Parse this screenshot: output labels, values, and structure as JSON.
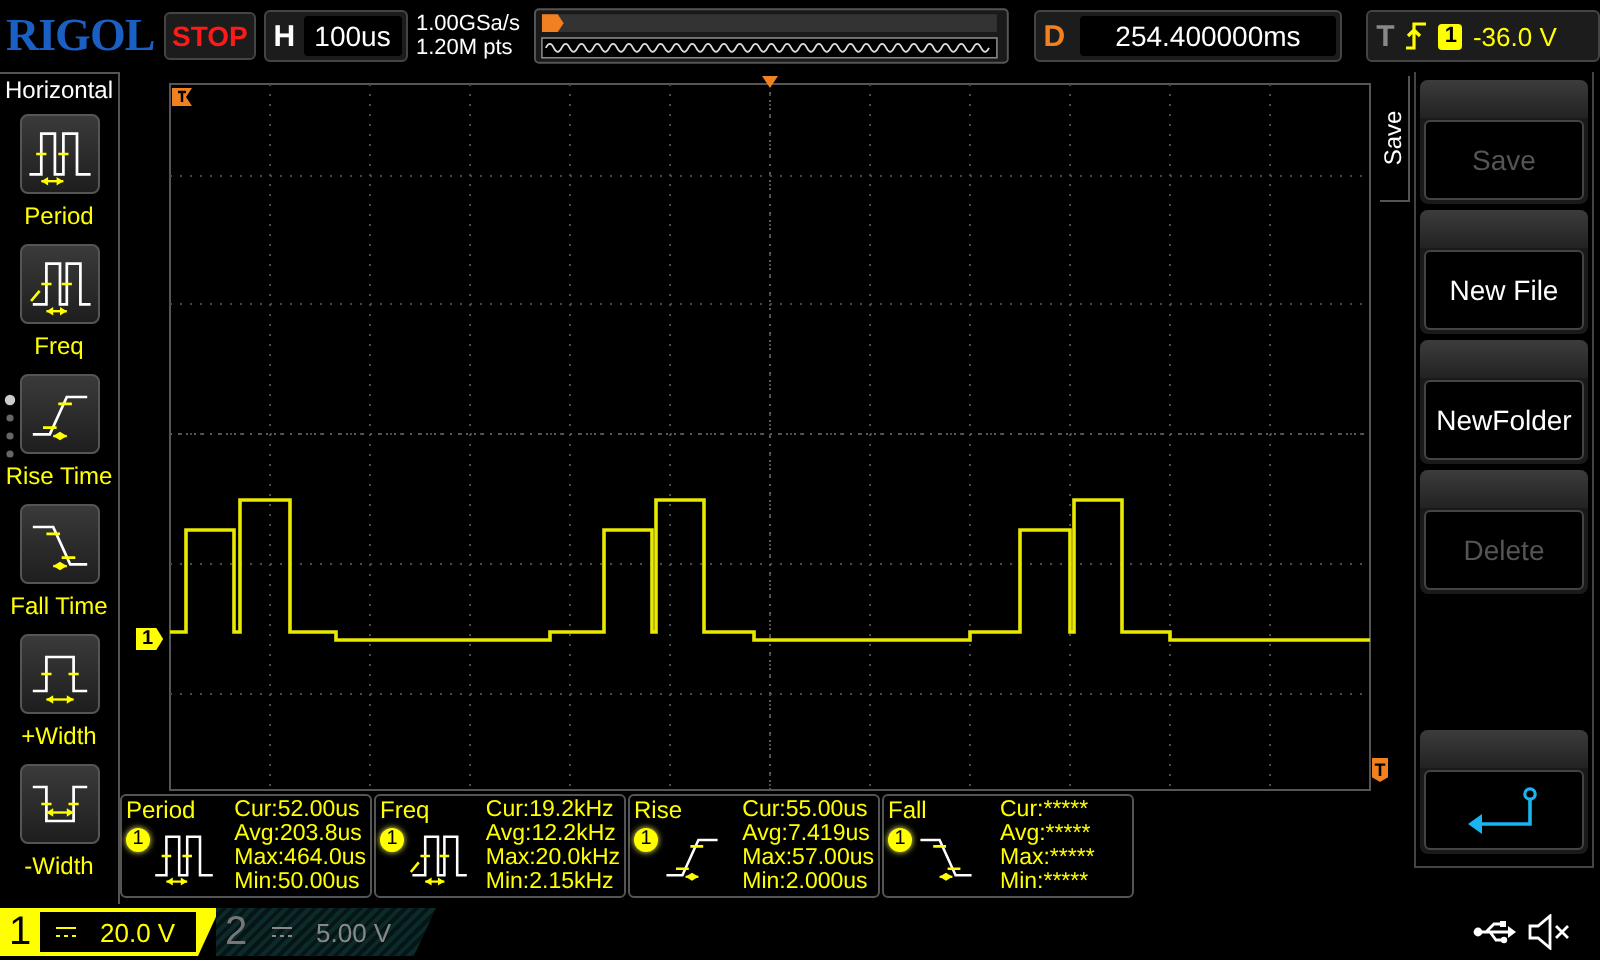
{
  "logo": "RIGOL",
  "run_state": "STOP",
  "timebase": {
    "label": "H",
    "value": "100us"
  },
  "acquisition": {
    "sample_rate": "1.00GSa/s",
    "memory_depth": "1.20M pts"
  },
  "delay": {
    "label": "D",
    "value": "254.400000ms"
  },
  "trigger": {
    "label": "T",
    "channel": "1",
    "level": "-36.0 V"
  },
  "measure_menu": {
    "title": "Horizontal",
    "items": [
      {
        "label": "Period",
        "kind": "period"
      },
      {
        "label": "Freq",
        "kind": "freq"
      },
      {
        "label": "Rise Time",
        "kind": "rise"
      },
      {
        "label": "Fall Time",
        "kind": "fall"
      },
      {
        "label": "+Width",
        "kind": "pwidth"
      },
      {
        "label": "-Width",
        "kind": "nwidth"
      }
    ]
  },
  "waveform": {
    "channel_marker": "1",
    "trigger_marker": "T"
  },
  "save_menu": {
    "title": "Save",
    "buttons": [
      {
        "kind": "text",
        "label": "Save",
        "disabled": true
      },
      {
        "kind": "text",
        "label": "New File",
        "disabled": false
      },
      {
        "kind": "text",
        "label": "NewFolder",
        "disabled": false
      },
      {
        "kind": "text",
        "label": "Delete",
        "disabled": true
      },
      {
        "kind": "back"
      }
    ]
  },
  "measurements": [
    {
      "name": "Period",
      "channel": "1",
      "kind": "period",
      "stats": [
        "Cur:52.00us",
        "Avg:203.8us",
        "Max:464.0us",
        "Min:50.00us"
      ]
    },
    {
      "name": "Freq",
      "channel": "1",
      "kind": "freq",
      "stats": [
        "Cur:19.2kHz",
        "Avg:12.2kHz",
        "Max:20.0kHz",
        "Min:2.15kHz"
      ]
    },
    {
      "name": "Rise",
      "channel": "1",
      "kind": "rise",
      "stats": [
        "Cur:55.00us",
        "Avg:7.419us",
        "Max:57.00us",
        "Min:2.000us"
      ]
    },
    {
      "name": "Fall",
      "channel": "1",
      "kind": "fall",
      "stats": [
        "Cur:*****",
        "Avg:*****",
        "Max:*****",
        "Min:*****"
      ]
    }
  ],
  "channels": [
    {
      "number": "1",
      "value": "20.0 V",
      "selected": true
    },
    {
      "number": "2",
      "value": "5.00 V",
      "selected": false
    }
  ]
}
